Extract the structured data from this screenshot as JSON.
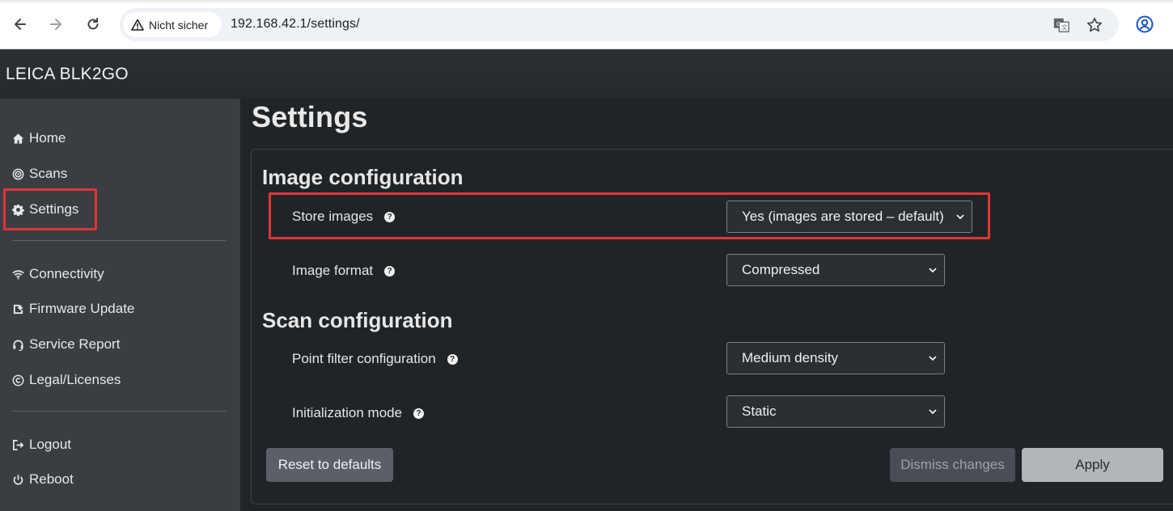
{
  "browser": {
    "security_label": "Nicht sicher",
    "url": "192.168.42.1/settings/"
  },
  "app": {
    "title": "LEICA BLK2GO"
  },
  "sidebar": {
    "items": [
      {
        "label": "Home",
        "icon": "home-icon"
      },
      {
        "label": "Scans",
        "icon": "scans-icon"
      },
      {
        "label": "Settings",
        "icon": "gear-icon",
        "active": true
      },
      {
        "label": "Connectivity",
        "icon": "wifi-icon"
      },
      {
        "label": "Firmware Update",
        "icon": "firmware-icon"
      },
      {
        "label": "Service Report",
        "icon": "headset-icon"
      },
      {
        "label": "Legal/Licenses",
        "icon": "copyright-icon"
      },
      {
        "label": "Logout",
        "icon": "logout-icon"
      },
      {
        "label": "Reboot",
        "icon": "power-icon"
      }
    ]
  },
  "page": {
    "title": "Settings"
  },
  "sections": {
    "image": {
      "title": "Image configuration",
      "store_images": {
        "label": "Store images",
        "value": "Yes (images are stored – default)"
      },
      "image_format": {
        "label": "Image format",
        "value": "Compressed"
      }
    },
    "scan": {
      "title": "Scan configuration",
      "point_filter": {
        "label": "Point filter configuration",
        "value": "Medium density"
      },
      "init_mode": {
        "label": "Initialization mode",
        "value": "Static"
      }
    }
  },
  "buttons": {
    "reset": "Reset to defaults",
    "dismiss": "Dismiss changes",
    "apply": "Apply"
  },
  "colors": {
    "highlight": "#e03636",
    "sidebar_bg": "#3a3d41",
    "main_bg": "#212427"
  }
}
